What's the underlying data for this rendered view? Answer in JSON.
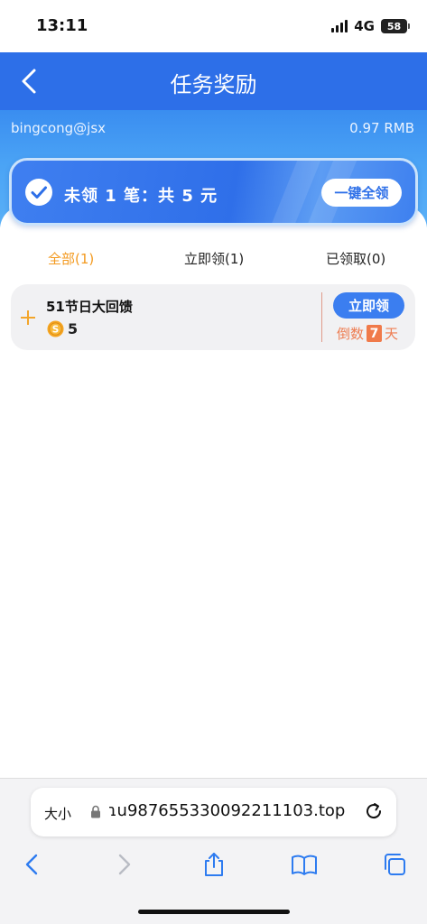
{
  "status_bar": {
    "time": "13:11",
    "network": "4G",
    "battery": "58"
  },
  "header": {
    "title": "任务奖励",
    "back_icon": "chevron-left-icon"
  },
  "account": {
    "username": "bingcong@jsx",
    "balance": "0.97 RMB"
  },
  "summary": {
    "text": "未领 1 笔：共 5 元",
    "claim_all_label": "一键全领",
    "icon": "check-circle-icon"
  },
  "tabs": [
    {
      "label": "全部(1)",
      "active": true
    },
    {
      "label": "立即领(1)",
      "active": false
    },
    {
      "label": "已领取(0)",
      "active": false
    }
  ],
  "tasks": [
    {
      "title": "51节日大回馈",
      "reward": "5",
      "claim_label": "立即领",
      "countdown_prefix": "倒数",
      "countdown_days": "7",
      "countdown_suffix": "天"
    }
  ],
  "browser": {
    "text_size_label": "大小",
    "url": "ɿu987655330092211103.top",
    "toolbar": [
      "back-icon",
      "forward-icon",
      "share-icon",
      "bookmarks-icon",
      "tabs-icon"
    ]
  },
  "colors": {
    "brand_blue": "#2d6fe8",
    "active_tab": "#f39a20",
    "countdown": "#ee7d52"
  }
}
